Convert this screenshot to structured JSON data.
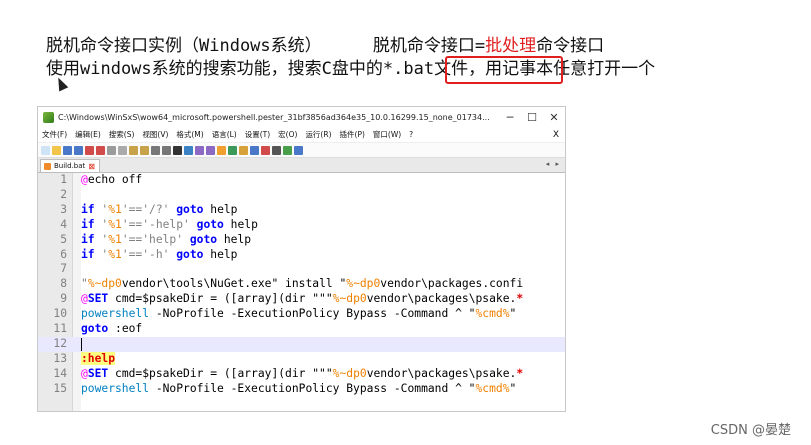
{
  "slide": {
    "line1_a": "脱机命令接口实例（Windows系统）",
    "line1_b": "脱机命令接口=",
    "line1_red": "批处理",
    "line1_c": "命令接口",
    "line2_a": "使用windows系统的搜索功能，搜索C盘中的",
    "line2_boxed": "*.bat文件，",
    "line2_b": "用记事本任意打开一个"
  },
  "window": {
    "title": "C:\\Windows\\WinSxS\\wow64_microsoft.powershell.pester_31bf3856ad364e35_10.0.16299.15_none_01734...",
    "minimize": "─",
    "maximize": "☐",
    "close": "✕",
    "menus": [
      "文件(F)",
      "编辑(E)",
      "搜索(S)",
      "视图(V)",
      "格式(M)",
      "语言(L)",
      "设置(T)",
      "宏(O)",
      "运行(R)",
      "插件(P)",
      "窗口(W)",
      "?"
    ],
    "menu_close": "X",
    "tab_label": "Build.bat",
    "tab_close": "⊠",
    "tab_arrows": "◂ ▸"
  },
  "code": {
    "line_numbers": [
      "1",
      "2",
      "3",
      "4",
      "5",
      "6",
      "7",
      "8",
      "9",
      "10",
      "11",
      "12",
      "13",
      "14",
      "15"
    ],
    "l1": [
      "@",
      "echo off"
    ],
    "l3": [
      "if",
      " '",
      "%1",
      "'=='/?' ",
      "goto",
      " help"
    ],
    "l4": [
      "if",
      " '",
      "%1",
      "'=='-help' ",
      "goto",
      " help"
    ],
    "l5": [
      "if",
      " '",
      "%1",
      "'=='help' ",
      "goto",
      " help"
    ],
    "l6": [
      "if",
      " '",
      "%1",
      "'=='-h' ",
      "goto",
      " help"
    ],
    "l8": [
      "\"",
      "%~dp0",
      "vendor\\tools\\NuGet.exe\" install \"",
      "%~dp0",
      "vendor\\packages.confi"
    ],
    "l9": [
      "@",
      "SET",
      " cmd=$psakeDir = ([array](dir \"\"\"",
      "%~dp0",
      "vendor\\packages\\psake.",
      "*"
    ],
    "l10": [
      "powershell",
      " -NoProfile -ExecutionPolicy Bypass -Command ^ \"",
      "%cmd%",
      "\""
    ],
    "l11": [
      "goto",
      " :eof"
    ],
    "l13": [
      ":help"
    ],
    "l14": [
      "@",
      "SET",
      " cmd=$psakeDir = ([array](dir \"\"\"",
      "%~dp0",
      "vendor\\packages\\psake.",
      "*"
    ],
    "l15": [
      "powershell",
      " -NoProfile -ExecutionPolicy Bypass -Command ^ \"",
      "%cmd%",
      "\""
    ]
  },
  "watermark": "CSDN @晏楚"
}
